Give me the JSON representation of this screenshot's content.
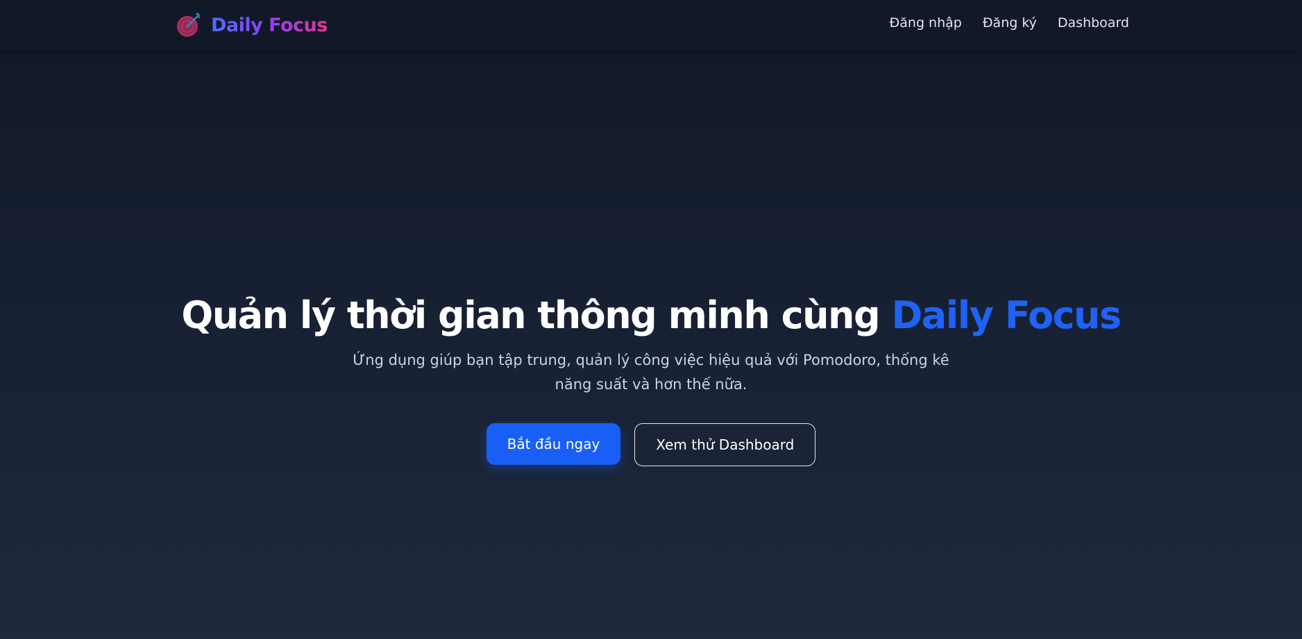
{
  "navbar": {
    "brand": {
      "name": "Daily Focus",
      "icon": "dart-target-icon"
    },
    "links": [
      {
        "label": "Đăng nhập"
      },
      {
        "label": "Đăng ký"
      },
      {
        "label": "Dashboard"
      }
    ]
  },
  "hero": {
    "title": "Quản lý thời gian thông minh cùng",
    "title_accent": "Daily Focus",
    "subtitle": "Ứng dụng giúp bạn tập trung, quản lý công việc hiệu quả với Pomodoro, thống kê năng suất và hơn thế nữa.",
    "primary_button": "Bắt đầu ngay",
    "secondary_button": "Xem thử Dashboard"
  },
  "colors": {
    "background_top": "#111827",
    "background_bottom": "#1e293b",
    "accent": "#1a5ff5",
    "brand_gradient_start": "#4f6bff",
    "brand_gradient_end": "#e8368f"
  }
}
